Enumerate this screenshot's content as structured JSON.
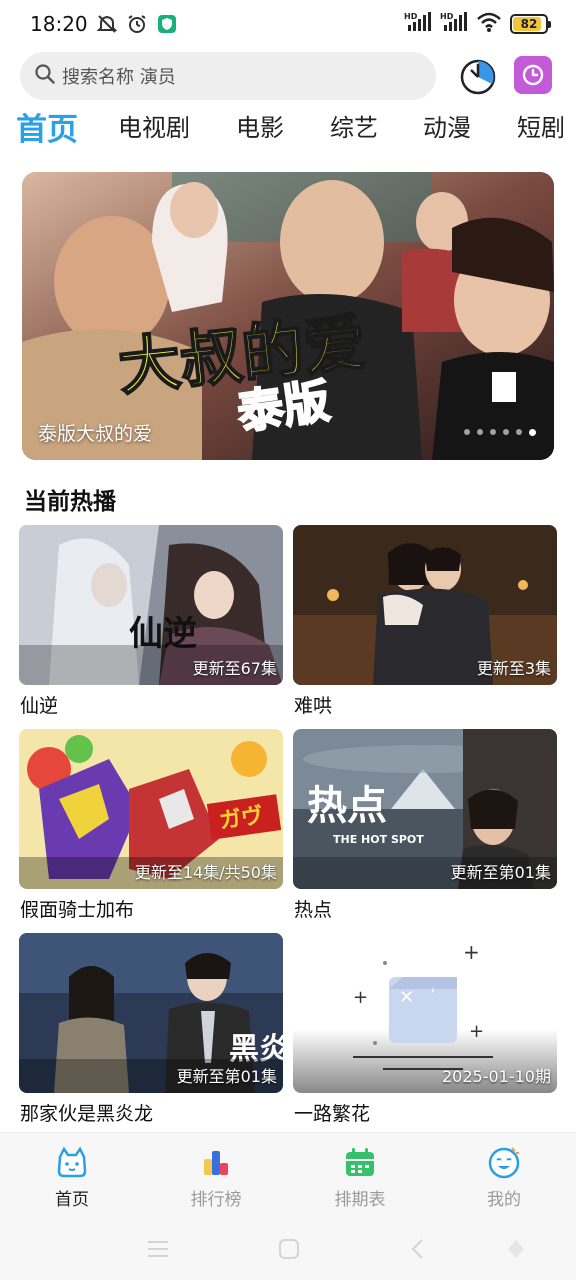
{
  "status": {
    "time": "18:20",
    "battery": "82",
    "network_1": "HD",
    "network_2": "HD"
  },
  "search": {
    "placeholder": "搜索名称 演员"
  },
  "tabs": [
    {
      "label": "首页",
      "active": true
    },
    {
      "label": "电视剧"
    },
    {
      "label": "电影"
    },
    {
      "label": "综艺"
    },
    {
      "label": "动漫"
    },
    {
      "label": "短剧"
    }
  ],
  "banner": {
    "caption": "泰版大叔的爱",
    "logo_text_1": "大叔的爱",
    "logo_text_2": "泰版",
    "dots": 6,
    "active_dot": 5
  },
  "section": {
    "title": "当前热播"
  },
  "cards": [
    {
      "title": "仙逆",
      "badge": "更新至67集",
      "art_text": "仙逆"
    },
    {
      "title": "难哄",
      "badge": "更新至3集"
    },
    {
      "title": "假面骑士加布",
      "badge": "更新至14集/共50集"
    },
    {
      "title": "热点",
      "badge": "更新至第01集",
      "art_text": "热点",
      "art_sub": "THE HOT SPOT"
    },
    {
      "title": "那家伙是黑炎龙",
      "badge": "更新至第01集"
    },
    {
      "title": "一路繁花",
      "badge": "2025-01-10期"
    }
  ],
  "bottom_nav": [
    {
      "label": "首页",
      "active": true
    },
    {
      "label": "排行榜"
    },
    {
      "label": "排期表"
    },
    {
      "label": "我的"
    }
  ],
  "colors": {
    "accent": "#2aa0e6",
    "timer_button": "#c35bd9",
    "rank_icon": [
      "#f2c94c",
      "#3b6fe0",
      "#e8455b"
    ],
    "schedule_icon": "#35c06a"
  }
}
